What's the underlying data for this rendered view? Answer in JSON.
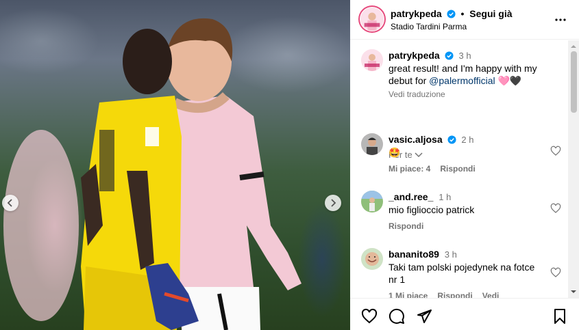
{
  "post": {
    "username": "patrykpeda",
    "follow_label": "Segui già",
    "dot": "•",
    "location": "Stadio Tardini Parma",
    "verified": true
  },
  "caption": {
    "username": "patrykpeda",
    "time": "3 h",
    "text_before": "great result! and I'm happy with my debut for ",
    "mention": "@palermofficial",
    "emoji": "🩷🖤",
    "translate": "Vedi traduzione"
  },
  "sort": {
    "label": "Per te"
  },
  "comments": [
    {
      "username": "vasic.aljosa",
      "verified": true,
      "time": "2 h",
      "text": "🤩",
      "likes": "Mi piace: 4",
      "reply": "Rispondi",
      "translate": ""
    },
    {
      "username": "_and.ree_",
      "verified": false,
      "time": "1 h",
      "text": "mio figlioccio patrick",
      "likes": "",
      "reply": "Rispondi",
      "translate": ""
    },
    {
      "username": "bananito89",
      "verified": false,
      "time": "3 h",
      "text": "Taki tam polski pojedynek na fotce nr 1",
      "likes": "1 Mi piace",
      "reply": "Rispondi",
      "translate": "Vedi traduzione"
    }
  ],
  "icons": {
    "more": "more-horizontal-icon",
    "like": "heart-icon",
    "comment": "comment-icon",
    "share": "share-icon",
    "save": "bookmark-icon",
    "prev": "chevron-left-icon",
    "next": "chevron-right-icon"
  },
  "colors": {
    "accent_link": "#00376b",
    "verified_blue": "#0095f6",
    "muted_text": "#737373",
    "keeper_yellow": "#f5d90a",
    "palermo_pink": "#f3c9d5"
  }
}
